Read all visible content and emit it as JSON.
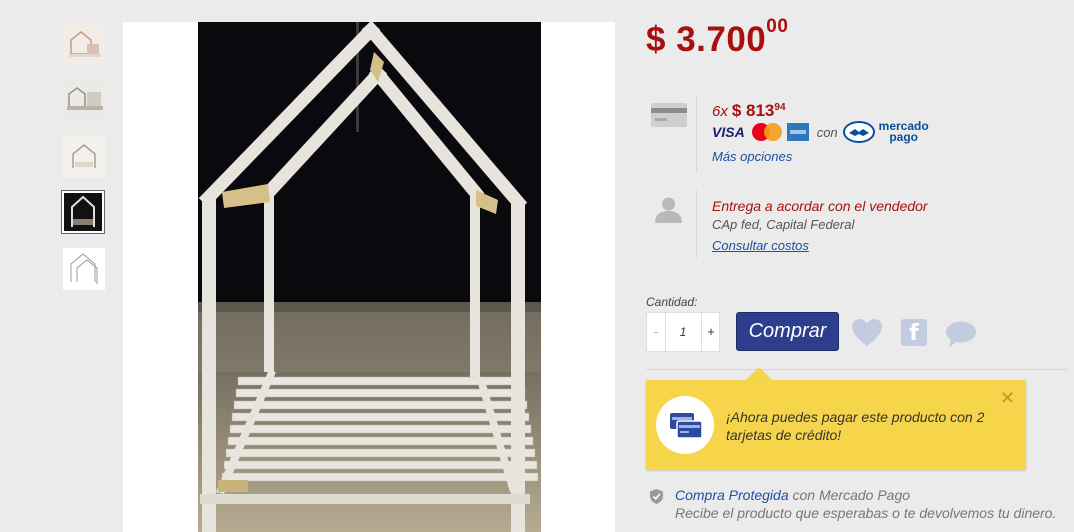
{
  "product": {
    "price_main": "$ 3.700",
    "price_cents": "00"
  },
  "payment": {
    "installments_qty": "6x",
    "installment_amount": "$ 813",
    "installment_cents": "94",
    "methods": [
      "VISA",
      "MasterCard",
      "American Express"
    ],
    "con_label": "con",
    "provider_line1": "mercado",
    "provider_line2": "pago",
    "more_options": "Más opciones"
  },
  "delivery": {
    "title": "Entrega a acordar con el vendedor",
    "location": "CAp fed, Capital Federal",
    "consult_link": "Consultar costos"
  },
  "purchase": {
    "quantity_label": "Cantidad:",
    "quantity_value": "1",
    "minus": "-",
    "plus": "+",
    "buy_label": "Comprar",
    "facebook_glyph": "f"
  },
  "banner": {
    "message": "¡Ahora puedes pagar este producto con 2 tarjetas de crédito!",
    "close": "✕"
  },
  "protection": {
    "link": "Compra Protegida",
    "rest": " con Mercado Pago",
    "description": "Recibe el producto que esperabas o te devolvemos tu dinero."
  },
  "gallery": {
    "thumbnail_count": 5,
    "active_index": 3
  },
  "colors": {
    "price": "#a90f0f",
    "link": "#1f4fa3",
    "buy_button": "#2d3e8c",
    "banner": "#f7d54a"
  }
}
